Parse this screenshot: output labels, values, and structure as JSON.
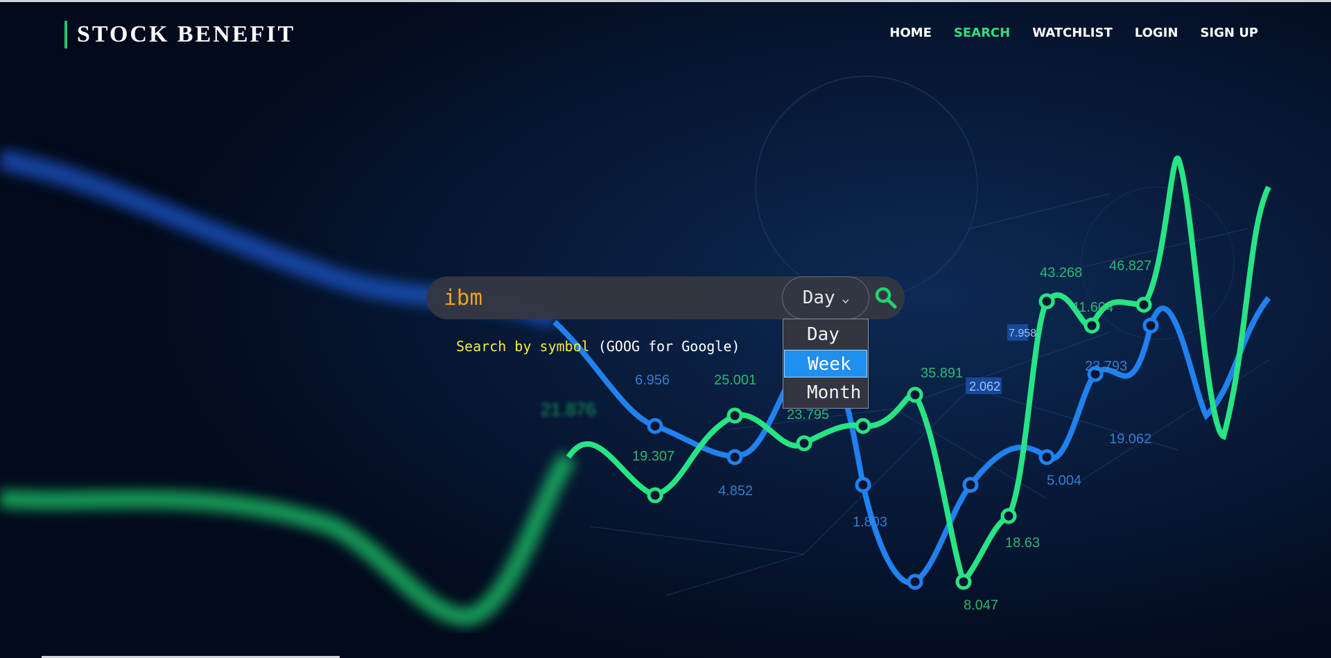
{
  "brand": {
    "name": "STOCK BENEFIT",
    "accent": "#22c76a"
  },
  "nav": {
    "items": [
      {
        "label": "HOME"
      },
      {
        "label": "SEARCH",
        "active": true
      },
      {
        "label": "WATCHLIST"
      },
      {
        "label": "LOGIN"
      },
      {
        "label": "SIGN UP"
      }
    ],
    "active_color": "#2ee07f"
  },
  "search": {
    "value": "ibm",
    "value_color": "#f0a21a",
    "hint_prefix": "Search by symbol",
    "hint_suffix": " (GOOG for Google)",
    "button_icon": "search-icon"
  },
  "period_select": {
    "selected": "Day",
    "options": [
      "Day",
      "Week",
      "Month"
    ],
    "highlighted": "Week"
  },
  "background": {
    "figure_numbers": [
      "6.956",
      "25.001",
      "21.876",
      "19.307",
      "4.852",
      "23.795",
      "35.891",
      "2.062",
      "1.803",
      "8.047",
      "18.63",
      "5.004",
      "19.062",
      "23.793",
      "43.268",
      "41.604",
      "46.827",
      "7.958"
    ]
  }
}
